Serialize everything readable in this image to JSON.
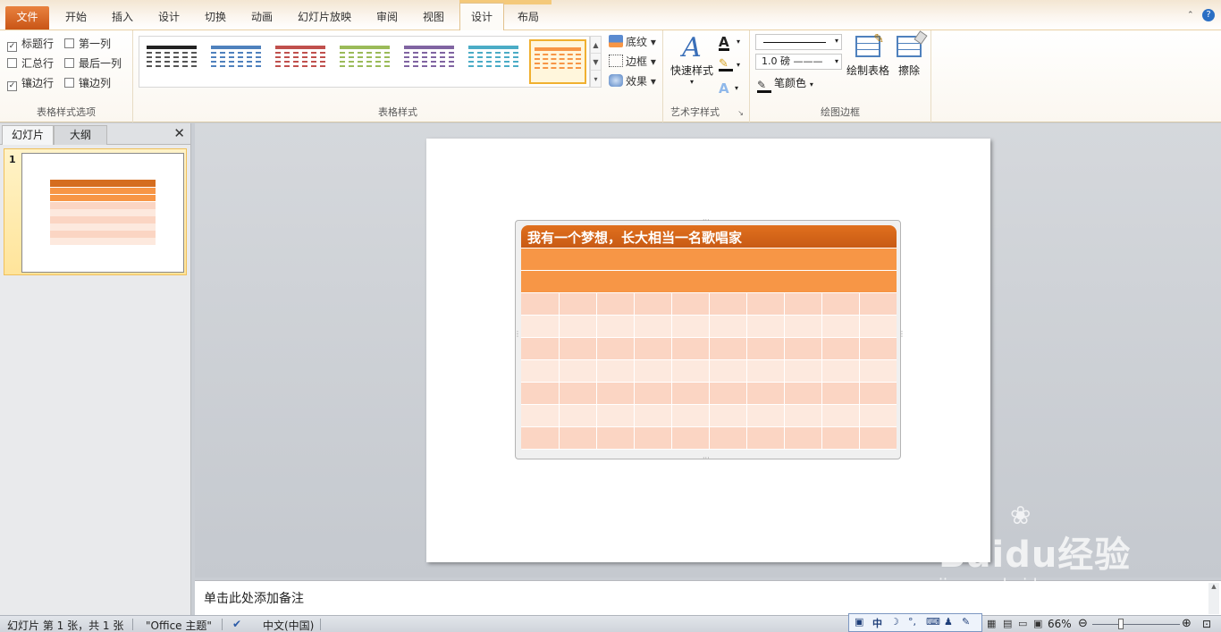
{
  "tabs": {
    "file": "文件",
    "home": "开始",
    "insert": "插入",
    "design": "设计",
    "transitions": "切换",
    "animations": "动画",
    "slideshow": "幻灯片放映",
    "review": "审阅",
    "view": "视图",
    "table_design": "设计",
    "layout": "布局"
  },
  "ribbon": {
    "style_options": {
      "header_row": "标题行",
      "total_row": "汇总行",
      "banded_rows": "镶边行",
      "first_column": "第一列",
      "last_column": "最后一列",
      "banded_columns": "镶边列",
      "label": "表格样式选项",
      "checked": {
        "header_row": true,
        "total_row": false,
        "banded_rows": true,
        "first_column": false,
        "last_column": false,
        "banded_columns": false
      }
    },
    "table_styles": {
      "label": "表格样式",
      "swatch_colors": [
        "#222222",
        "#4f81bd",
        "#c0504d",
        "#9bbb59",
        "#8064a2",
        "#4bacc6",
        "#f79646"
      ],
      "selected_index": 6,
      "shading": "底纹",
      "borders": "边框",
      "effects": "效果"
    },
    "wordart": {
      "quick_styles": "快速样式",
      "label": "艺术字样式"
    },
    "draw_borders": {
      "pen_weight": "1.0 磅",
      "pen_color": "笔颜色",
      "draw_table": "绘制表格",
      "eraser": "擦除",
      "label": "绘图边框"
    }
  },
  "left_panel": {
    "tab_slides": "幻灯片",
    "tab_outline": "大纲",
    "close": "✕",
    "thumb_number": "1"
  },
  "slide": {
    "table_title": "我有一个梦想，长大相当一名歌唱家"
  },
  "notes": {
    "placeholder": "单击此处添加备注"
  },
  "status": {
    "slide_info": "幻灯片 第 1 张，共 1 张",
    "theme": "\"Office 主题\"",
    "language": "中文(中国)",
    "zoom": "66%"
  },
  "ime": {
    "mode": "中"
  },
  "watermark": {
    "brand": "Baidu经验",
    "url": "jingyan.baidu.com"
  },
  "colors": {
    "accent_orange": "#f79646",
    "title_orange": "#e0701e",
    "band_light": "#fde9de",
    "band_mid": "#fbd5c3"
  }
}
